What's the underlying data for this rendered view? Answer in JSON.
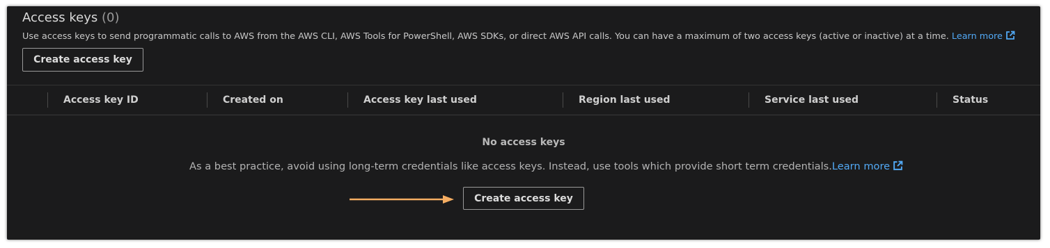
{
  "section": {
    "title": "Access keys",
    "count": "(0)",
    "description": "Use access keys to send programmatic calls to AWS from the AWS CLI, AWS Tools for PowerShell, AWS SDKs, or direct AWS API calls. You can have a maximum of two access keys (active or inactive) at a time.",
    "learn_more": "Learn more",
    "create_button": "Create access key"
  },
  "table": {
    "columns": [
      "Access key ID",
      "Created on",
      "Access key last used",
      "Region last used",
      "Service last used",
      "Status"
    ]
  },
  "empty_state": {
    "title": "No access keys",
    "description": "As a best practice, avoid using long-term credentials like access keys. Instead, use tools which provide short term credentials.",
    "learn_more": "Learn more",
    "create_button": "Create access key"
  },
  "colors": {
    "panel_bg": "#1b1b1c",
    "link": "#52a9f5",
    "annotation_arrow": "#f5ad62"
  },
  "icons": {
    "external_link": "external-link-icon",
    "annotation_arrow": "arrow-right-icon"
  }
}
